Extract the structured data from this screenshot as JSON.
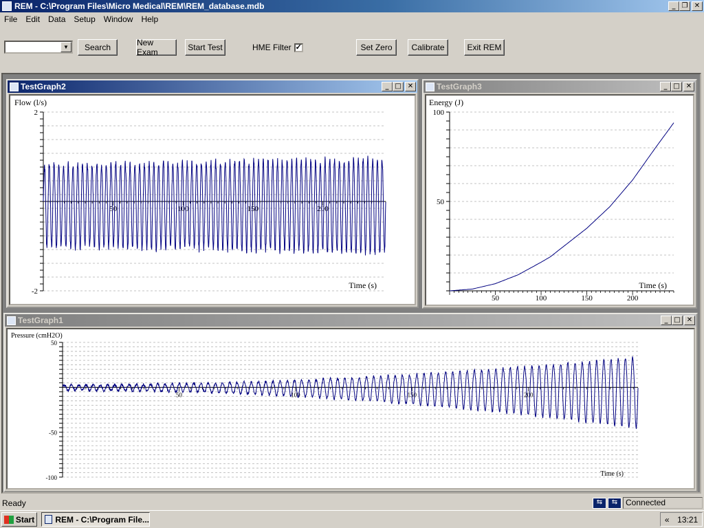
{
  "window": {
    "title": "REM - C:\\Program Files\\Micro Medical\\REM\\REM_database.mdb"
  },
  "menu": [
    "File",
    "Edit",
    "Data",
    "Setup",
    "Window",
    "Help"
  ],
  "toolbar": {
    "search_label": "Search",
    "new_exam_label": "New Exam",
    "start_test_label": "Start Test",
    "hme_label": "HME Filter",
    "hme_checked": "✓",
    "set_zero_label": "Set Zero",
    "calibrate_label": "Calibrate",
    "exit_label": "Exit REM"
  },
  "graphs": {
    "graph2": {
      "title": "TestGraph2"
    },
    "graph3": {
      "title": "TestGraph3"
    },
    "graph1": {
      "title": "TestGraph1"
    }
  },
  "chart_data": [
    {
      "type": "line",
      "ylabel": "Flow (l/s)",
      "xlabel": "Time (s)",
      "ylim": [
        -2,
        2
      ],
      "xlim": [
        0,
        245
      ],
      "x_ticks": [
        50,
        100,
        150,
        200
      ],
      "y_ticks": [
        2,
        -2
      ],
      "signal": {
        "kind": "oscillation",
        "cycles": 72,
        "amplitude_pos": 0.82,
        "amplitude_neg": -1.0,
        "amplitude_growth": 0.15
      },
      "line_color": "#000080"
    },
    {
      "type": "line",
      "ylabel": "Energy (J)",
      "xlabel": "Time (s)",
      "ylim": [
        0,
        100
      ],
      "xlim": [
        0,
        245
      ],
      "x_ticks": [
        50,
        100,
        150,
        200
      ],
      "y_ticks": [
        100,
        50
      ],
      "points": [
        [
          0,
          0
        ],
        [
          25,
          1
        ],
        [
          50,
          4
        ],
        [
          75,
          9
        ],
        [
          100,
          16
        ],
        [
          110,
          19
        ],
        [
          125,
          25
        ],
        [
          150,
          35
        ],
        [
          175,
          47
        ],
        [
          200,
          62
        ],
        [
          225,
          80
        ],
        [
          245,
          94
        ]
      ],
      "line_color": "#000080"
    },
    {
      "type": "line",
      "ylabel": "Pressure (cmH2O)",
      "xlabel": "Time (s)",
      "ylim": [
        -100,
        50
      ],
      "xlim": [
        0,
        247
      ],
      "x_ticks": [
        50,
        100,
        150,
        200
      ],
      "y_ticks": [
        50,
        -50,
        -100
      ],
      "signal": {
        "kind": "oscillation",
        "cycles": 80,
        "amplitude_start": 3,
        "amplitude_end": 40,
        "negative_end": -50
      },
      "line_color": "#000080"
    }
  ],
  "status": {
    "ready": "Ready",
    "connected": "Connected"
  },
  "taskbar": {
    "start_label": "Start",
    "task_label": "REM - C:\\Program File...",
    "tray_arrow": "«",
    "clock": "13:21"
  }
}
